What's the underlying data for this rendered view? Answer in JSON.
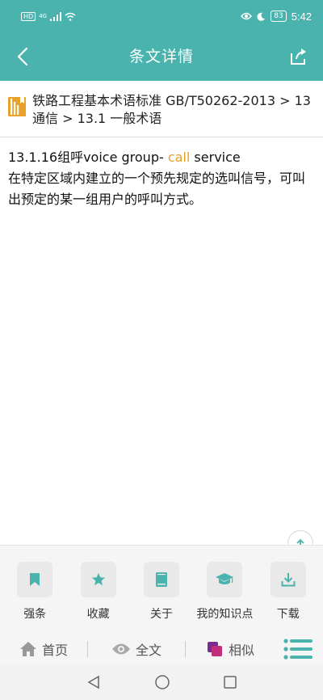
{
  "statusbar": {
    "hd": "HD",
    "signal": "4G",
    "battery": "83",
    "time": "5:42"
  },
  "appbar": {
    "title": "条文详情"
  },
  "breadcrumb": {
    "text": "铁路工程基本术语标准 GB/T50262-2013 > 13 通信 > 13.1 一般术语"
  },
  "content": {
    "term_prefix": "13.1.16组呼voice group- ",
    "term_highlight": "call",
    "term_suffix": " service",
    "definition": "在特定区域内建立的一个预先规定的选叫信号，可叫出预定的某一组用户的呼叫方式。"
  },
  "actions": [
    {
      "label": "强条",
      "icon": "bookmark-icon"
    },
    {
      "label": "收藏",
      "icon": "star-icon"
    },
    {
      "label": "关于",
      "icon": "book-icon"
    },
    {
      "label": "我的知识点",
      "icon": "graduation-cap-icon"
    },
    {
      "label": "下载",
      "icon": "download-icon"
    }
  ],
  "bottomnav": {
    "home": "首页",
    "fulltext": "全文",
    "similar": "相似"
  },
  "colors": {
    "primary": "#4bb3ad",
    "highlight": "#e8a12a",
    "accent_similar": "#c0307a"
  }
}
